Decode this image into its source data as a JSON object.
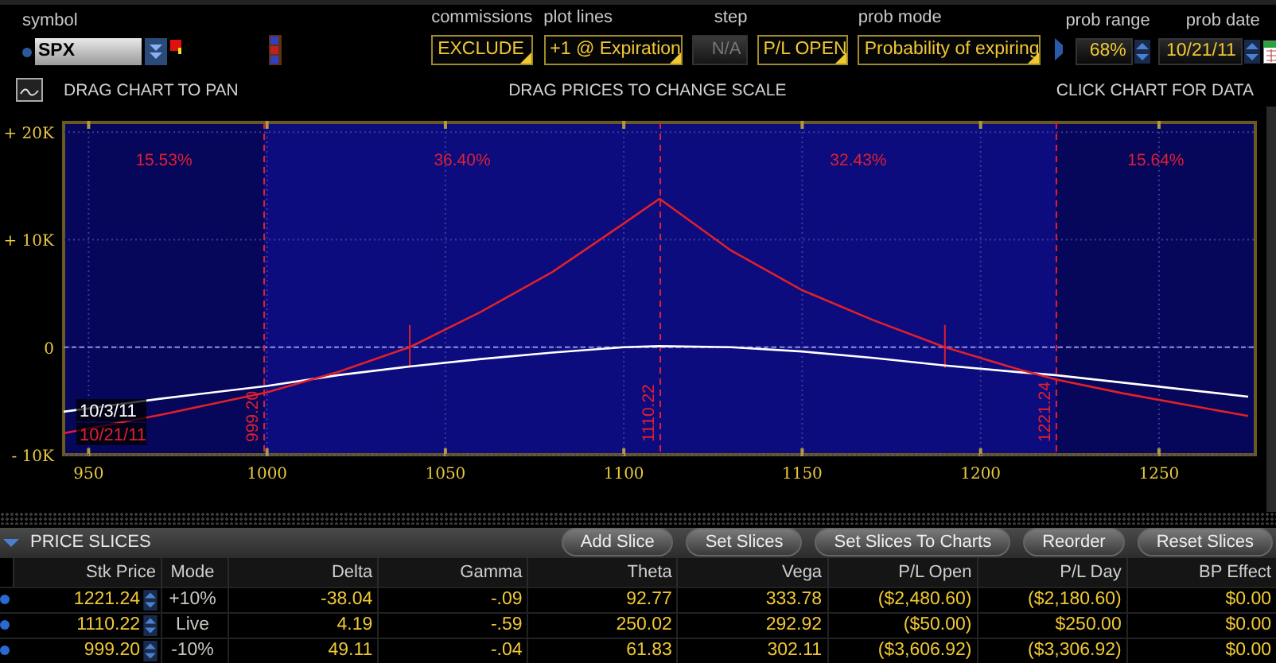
{
  "toolbar": {
    "fields": [
      {
        "kind": "symbol",
        "label": "symbol",
        "value": "SPX"
      },
      {
        "kind": "dropdown",
        "label": "commissions",
        "value": "EXCLUDE"
      },
      {
        "kind": "dropdown",
        "label": "plot lines",
        "value": "+1 @ Expiration"
      },
      {
        "kind": "disabled",
        "label": "step",
        "value": "N/A"
      },
      {
        "kind": "dropdown",
        "value": "P/L OPEN"
      },
      {
        "kind": "dropdown",
        "label": "prob mode",
        "value": "Probability of expiring"
      },
      {
        "kind": "spinner",
        "label": "prob range",
        "value": "68%"
      },
      {
        "kind": "date",
        "label": "prob date",
        "value": "10/21/11"
      }
    ]
  },
  "hints": [
    "DRAG CHART TO PAN",
    "DRAG PRICES TO CHANGE SCALE",
    "CLICK CHART FOR DATA"
  ],
  "chart_data": {
    "type": "line",
    "x": [
      943,
      970,
      1000,
      1020,
      1040,
      1060,
      1080,
      1100,
      1110,
      1130,
      1150,
      1170,
      1190,
      1210,
      1221,
      1240,
      1275
    ],
    "series": [
      {
        "name": "10/3/11",
        "color": "#ffffff",
        "values": [
          -6000,
          -4800,
          -3600,
          -2600,
          -1800,
          -1100,
          -500,
          0,
          100,
          0,
          -400,
          -1000,
          -1700,
          -2300,
          -2600,
          -3300,
          -4600
        ]
      },
      {
        "name": "10/21/11",
        "color": "#e0202a",
        "values": [
          -8000,
          -6300,
          -4200,
          -2300,
          0,
          3300,
          7000,
          11500,
          13800,
          9000,
          5300,
          2500,
          0,
          -2000,
          -3000,
          -4300,
          -6400
        ]
      }
    ],
    "xlim": [
      943,
      1277
    ],
    "ylim": [
      -10000,
      20900
    ],
    "xticks": [
      950,
      1000,
      1050,
      1100,
      1150,
      1200,
      1250
    ],
    "yticks": [
      {
        "value": -10000,
        "label": "- 10K"
      },
      {
        "value": 0,
        "label": "0"
      },
      {
        "value": 10000,
        "label": "+ 10K"
      },
      {
        "value": 20000,
        "label": "+ 20K"
      }
    ],
    "grid": true,
    "annotations": [
      "15.53%",
      "36.40%",
      "32.43%",
      "15.64%"
    ],
    "ref_lines": [
      {
        "axis": "x",
        "value": 999.2,
        "label": "999.20"
      },
      {
        "axis": "x",
        "value": 1110.22,
        "label": "1110.22"
      },
      {
        "axis": "x",
        "value": 1221.24,
        "label": "1221.24"
      },
      {
        "axis": "y",
        "value": 0
      }
    ],
    "bands": [
      {
        "axis": "x",
        "from": 999.2,
        "to": 1221.24
      }
    ]
  },
  "price_slices": {
    "title": "PRICE SLICES",
    "expanded": true,
    "buttons": [
      "Add Slice",
      "Set Slices",
      "Set Slices To Charts",
      "Reorder",
      "Reset Slices"
    ],
    "columns": [
      "Stk Price",
      "Mode",
      "Delta",
      "Gamma",
      "Theta",
      "Vega",
      "P/L Open",
      "P/L Day",
      "BP Effect"
    ],
    "rows": [
      [
        "1221.24",
        "+10%",
        "-38.04",
        "-.09",
        "92.77",
        "333.78",
        "($2,480.60)",
        "($2,180.60)",
        "$0.00"
      ],
      [
        "1110.22",
        "Live",
        "4.19",
        "-.59",
        "250.02",
        "292.92",
        "($50.00)",
        "$250.00",
        "$0.00"
      ],
      [
        "999.20",
        "-10%",
        "49.11",
        "-.04",
        "61.83",
        "302.11",
        "($3,606.92)",
        "($3,306.92)",
        "$0.00"
      ]
    ]
  }
}
